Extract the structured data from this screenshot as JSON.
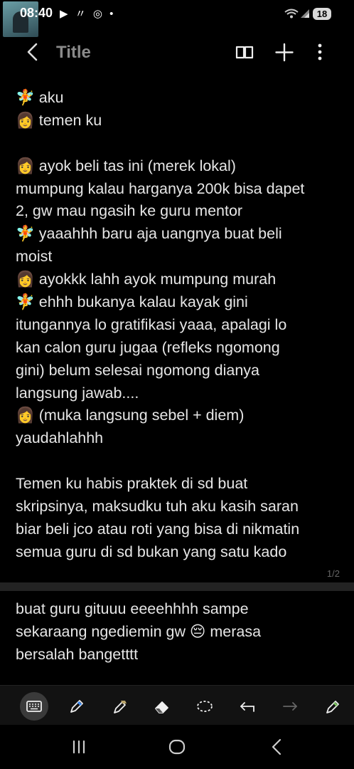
{
  "status": {
    "time": "08:40",
    "notification_icons": "▶ 〃 ◎ •",
    "battery": "18"
  },
  "app_bar": {
    "title": "Title"
  },
  "note": {
    "page1_lines": [
      "🧚 aku",
      "👩 temen ku",
      "",
      "👩  ayok beli tas ini (merek lokal)",
      "mumpung kalau harganya 200k bisa dapet",
      "2, gw mau ngasih ke guru mentor",
      "🧚 yaaahhh baru aja uangnya buat beli",
      "moist",
      "👩 ayokkk lahh ayok mumpung murah",
      "🧚 ehhh bukanya kalau kayak gini",
      "itungannya lo gratifikasi yaaa, apalagi lo",
      "kan calon guru jugaa (refleks ngomong",
      "gini) belum selesai ngomong dianya",
      "langsung jawab....",
      "👩 (muka langsung sebel + diem)",
      "yaudahlahhh",
      "",
      "Temen ku habis praktek di sd buat",
      "skripsinya, maksudku tuh aku kasih saran",
      "biar beli jco atau roti yang bisa di nikmatin",
      "semua guru di sd bukan yang satu kado"
    ],
    "page_indicator": "1/2",
    "page2_lines": [
      "buat guru gituuu eeeehhhh sampe",
      "sekaraang ngediemin gw 😔  merasa",
      "bersalah bangetttt"
    ]
  }
}
